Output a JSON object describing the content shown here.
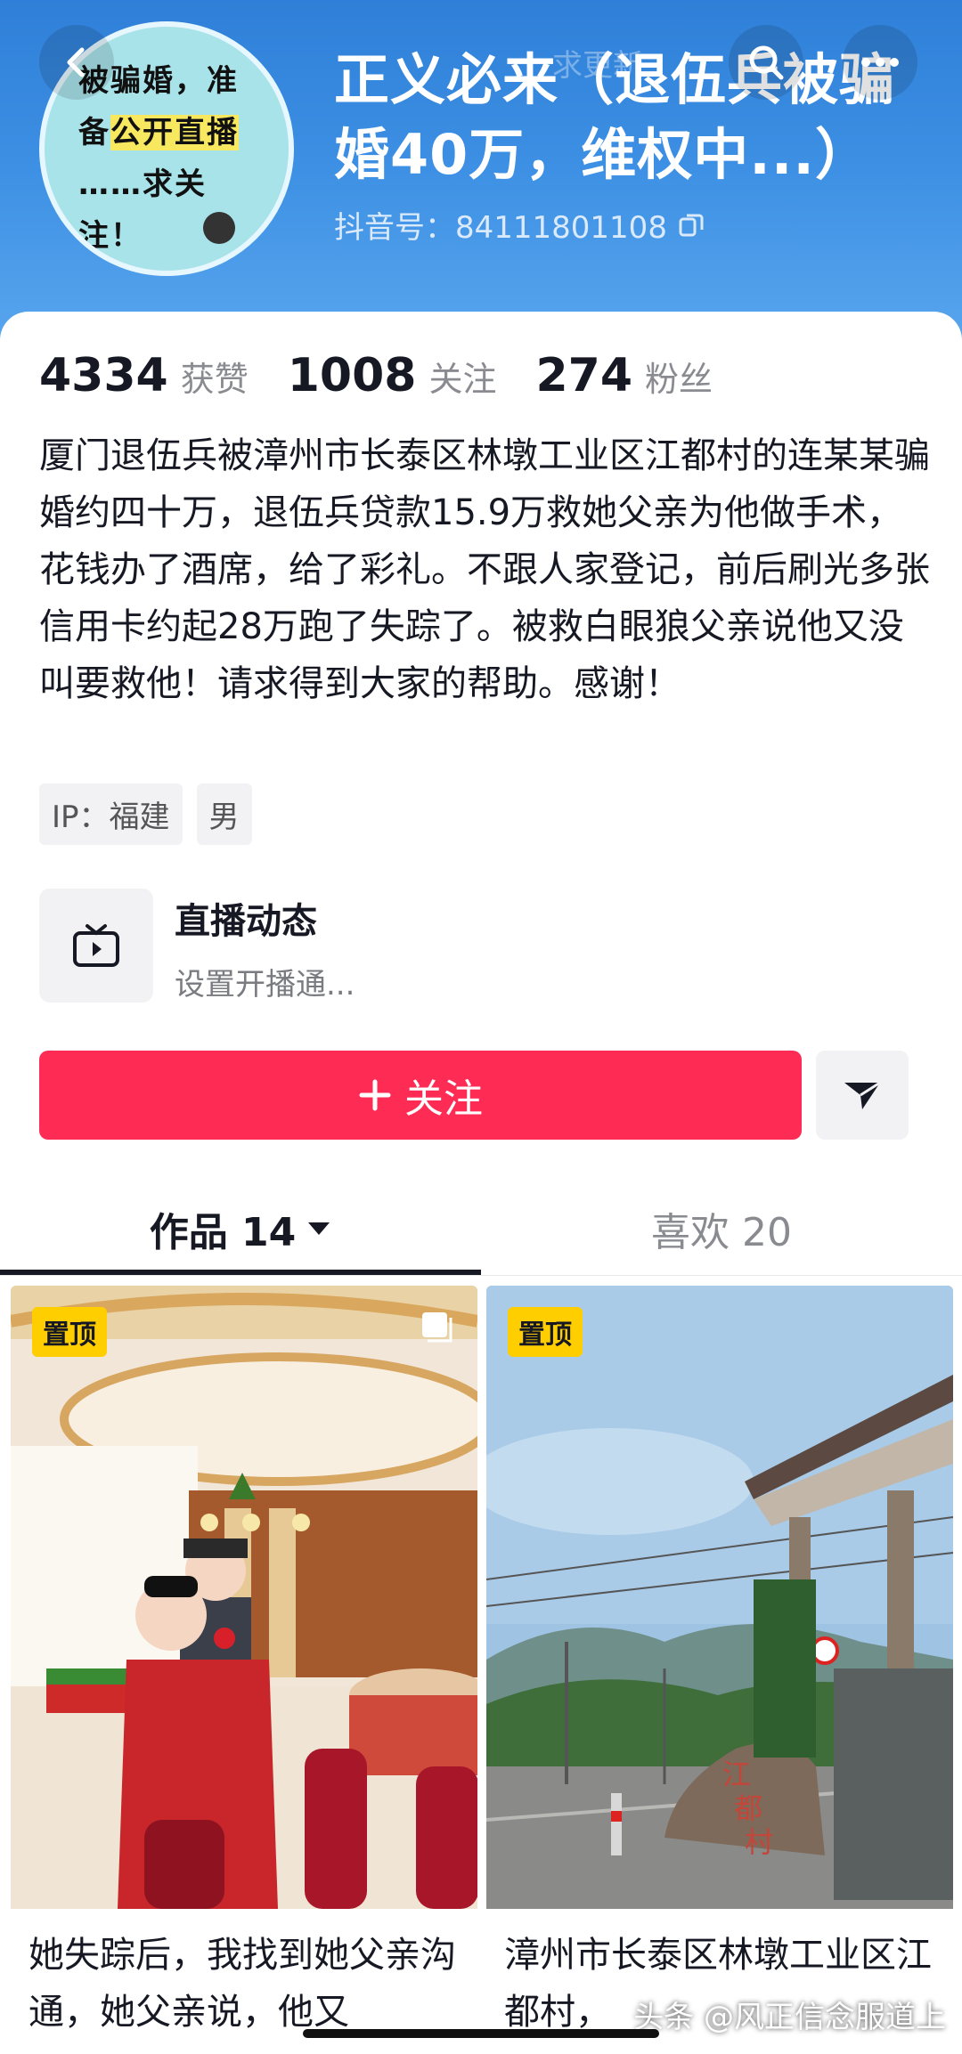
{
  "header": {
    "ghost_text": "求更新",
    "name": "正义必来（退伍兵被骗婚40万，维权中...）",
    "account_id": "抖音号：84111801108"
  },
  "avatar": {
    "text_line1": "被骗婚，准",
    "text_line2_pre": "备",
    "text_line2_hl": "公开直播",
    "text_line3": "……求关",
    "text_line4": "注！"
  },
  "stats": [
    {
      "num": "4334",
      "label": "获赞"
    },
    {
      "num": "1008",
      "label": "关注"
    },
    {
      "num": "274",
      "label": "粉丝"
    }
  ],
  "bio": "厦门退伍兵被漳州市长泰区林墩工业区江都村的连某某骗婚约四十万，退伍兵贷款15.9万救她父亲为他做手术，花钱办了酒席，给了彩礼。不跟人家登记，前后刷光多张信用卡约起28万跑了失踪了。被救白眼狼父亲说他又没叫要救他！请求得到大家的帮助。感谢！",
  "tags": [
    "IP：福建",
    "男"
  ],
  "live": {
    "title": "直播动态",
    "subtitle": "设置开播通..."
  },
  "follow_button": "关注",
  "tabs": {
    "works": "作品 14",
    "likes": "喜欢 20"
  },
  "videos": [
    {
      "badge": "置顶",
      "title": "她失踪后，我找到她父亲沟通，她父亲说，他又"
    },
    {
      "badge": "置顶",
      "title": "漳州市长泰区林墩工业区江都村，"
    }
  ],
  "watermark": "头条 @风正信念服道上",
  "colors": {
    "follow": "#fe2c55",
    "pin_badge": "#fece00",
    "header_blue": "#3c8fe3"
  }
}
